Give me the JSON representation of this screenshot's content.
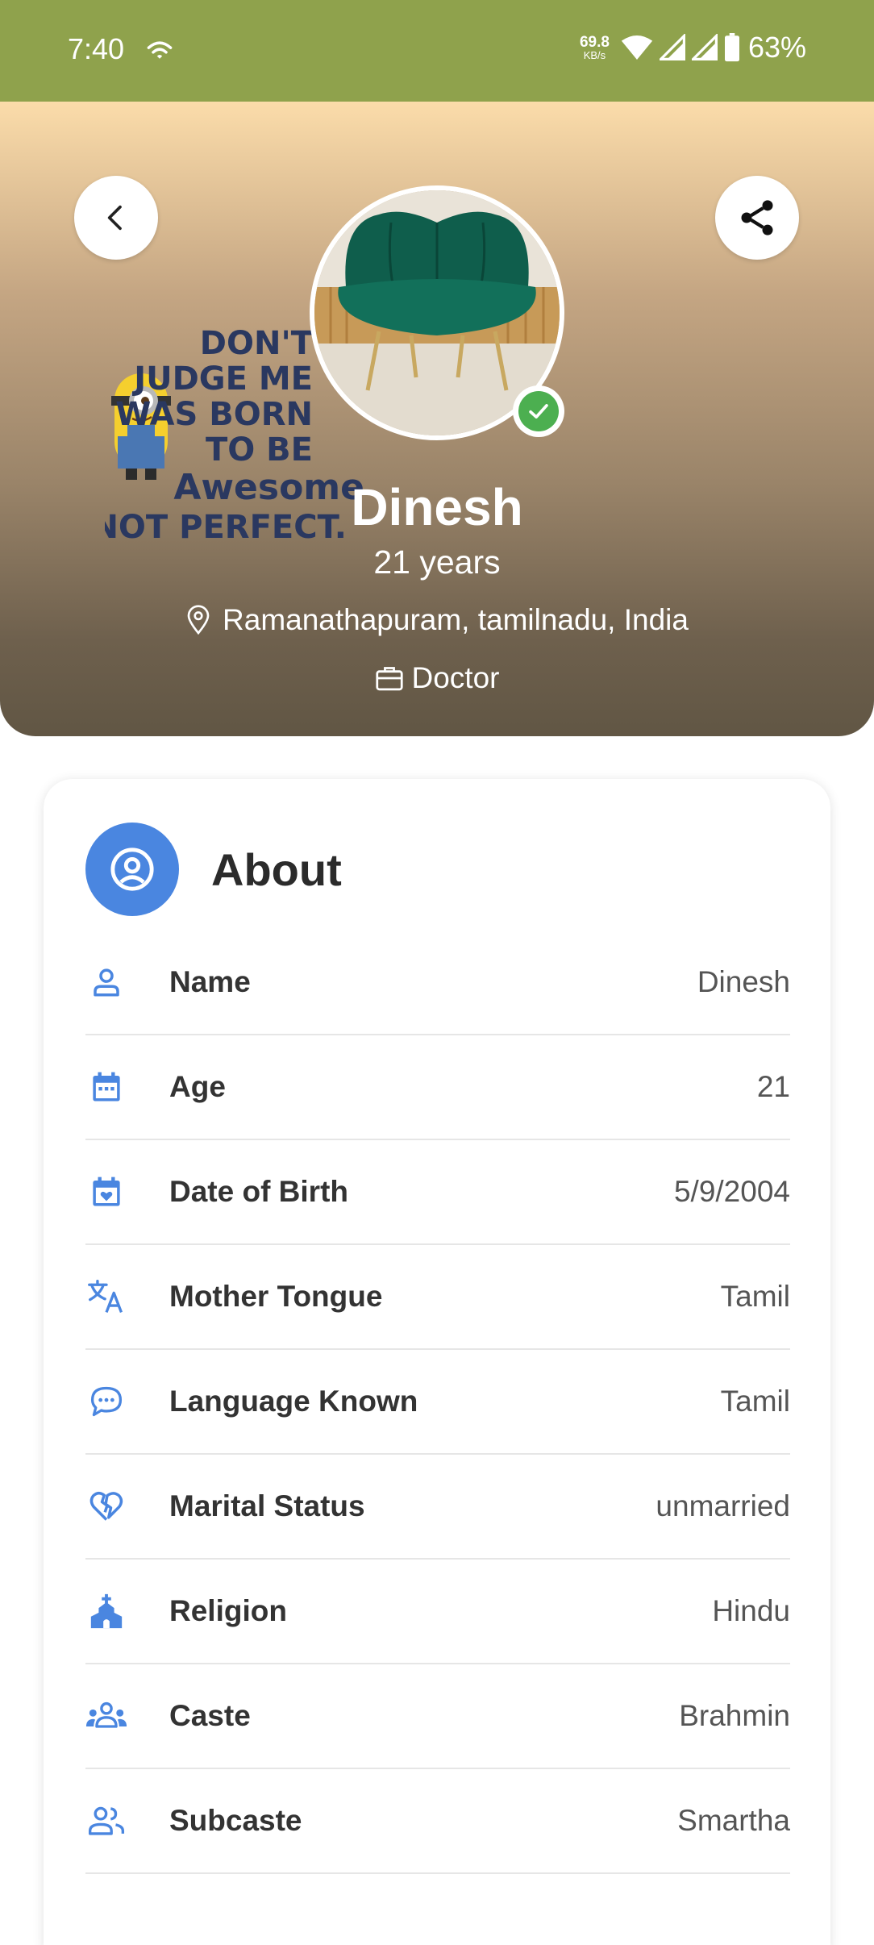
{
  "status_bar": {
    "time": "7:40",
    "speed_value": "69.8",
    "speed_unit": "KB/s",
    "battery": "63%"
  },
  "header": {
    "artwork_text": [
      "DON'T",
      "JUDGE ME",
      "I WAS BORN",
      "TO BE",
      "Awesome",
      "NOT PERFECT."
    ]
  },
  "profile": {
    "name": "Dinesh",
    "age": "21 years",
    "location": "Ramanathapuram, tamilnadu, India",
    "profession": "Doctor",
    "verified": true
  },
  "about": {
    "title": "About",
    "rows": [
      {
        "icon": "person-icon",
        "label": "Name",
        "value": "Dinesh"
      },
      {
        "icon": "calendar-icon",
        "label": "Age",
        "value": "21"
      },
      {
        "icon": "calendar-heart-icon",
        "label": "Date of Birth",
        "value": "5/9/2004"
      },
      {
        "icon": "translate-icon",
        "label": "Mother Tongue",
        "value": "Tamil"
      },
      {
        "icon": "chat-bubble-icon",
        "label": "Language Known",
        "value": "Tamil"
      },
      {
        "icon": "broken-heart-icon",
        "label": "Marital Status",
        "value": "unmarried"
      },
      {
        "icon": "church-icon",
        "label": "Religion",
        "value": "Hindu"
      },
      {
        "icon": "groups-icon",
        "label": "Caste",
        "value": "Brahmin"
      },
      {
        "icon": "people-icon",
        "label": "Subcaste",
        "value": "Smartha"
      }
    ]
  },
  "colors": {
    "status_bar": "#8fa24c",
    "accent_blue": "#4a86e0",
    "verified_green": "#4caf50"
  }
}
